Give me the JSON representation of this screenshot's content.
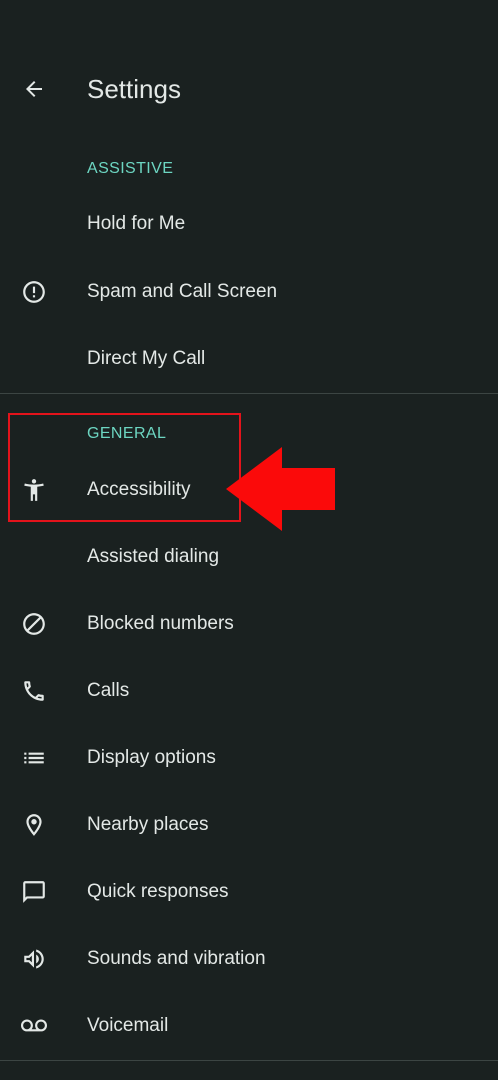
{
  "header": {
    "title": "Settings",
    "back_icon": "arrow-back-icon"
  },
  "sections": {
    "assistive": {
      "header": "ASSISTIVE",
      "items": [
        {
          "label": "Hold for Me",
          "icon": ""
        },
        {
          "label": "Spam and Call Screen",
          "icon": "alert-circle-icon"
        },
        {
          "label": "Direct My Call",
          "icon": ""
        }
      ]
    },
    "general": {
      "header": "GENERAL",
      "items": [
        {
          "label": "Accessibility",
          "icon": "accessibility-icon"
        },
        {
          "label": "Assisted dialing",
          "icon": ""
        },
        {
          "label": "Blocked numbers",
          "icon": "block-icon"
        },
        {
          "label": "Calls",
          "icon": "phone-icon"
        },
        {
          "label": "Display options",
          "icon": "list-icon"
        },
        {
          "label": "Nearby places",
          "icon": "location-pin-icon"
        },
        {
          "label": "Quick responses",
          "icon": "chat-bubble-icon"
        },
        {
          "label": "Sounds and vibration",
          "icon": "volume-icon"
        },
        {
          "label": "Voicemail",
          "icon": "voicemail-icon"
        }
      ]
    }
  },
  "annotation": {
    "highlight_color": "#e3131b",
    "arrow_icon": "red-arrow-left-icon"
  },
  "colors": {
    "background": "#1a2120",
    "accent": "#6dd6c2",
    "text": "#e3e8e6",
    "divider": "#3c4543"
  }
}
